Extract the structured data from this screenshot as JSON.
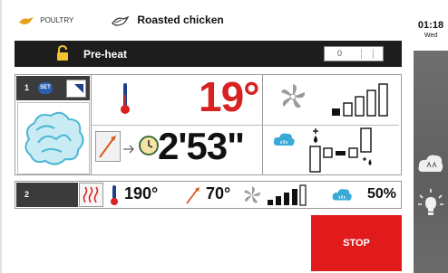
{
  "header": {
    "category_label": "POULTRY",
    "category_icon": "chicken-icon",
    "recipe_name": "Roasted chicken",
    "recipe_icon": "roast-icon"
  },
  "clock": {
    "time": "01:18",
    "day": "Wed"
  },
  "preheat": {
    "label": "Pre-heat",
    "value": "0"
  },
  "step1": {
    "number": "1",
    "badge": "SET",
    "temperature": "19°",
    "time": "2'53\"",
    "fan_level": 4,
    "humidity_level": 2
  },
  "step2": {
    "number": "2",
    "temperature": "190°",
    "core_temperature": "70°",
    "fan_level": 4,
    "humidity": "50%"
  },
  "actions": {
    "stop_label": "STOP"
  },
  "colors": {
    "accent_red": "#d82121",
    "stop_red": "#e11b1b",
    "set_blue": "#2a5fb4",
    "bar_dark": "#1d1d1d"
  }
}
